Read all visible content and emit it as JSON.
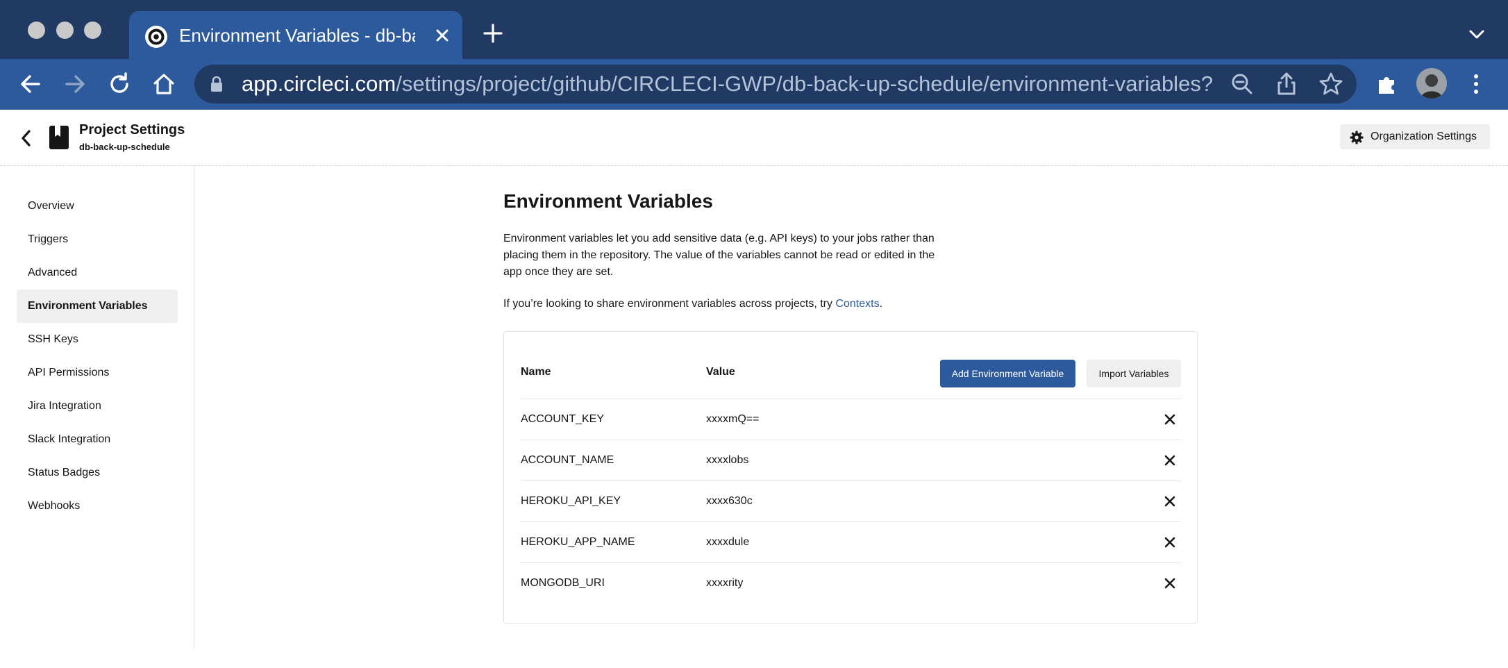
{
  "browser": {
    "tab_title": "Environment Variables - db-back-up-schedule",
    "url_host": "app.circleci.com",
    "url_path": "/settings/project/github/CIRCLECI-GWP/db-back-up-schedule/environment-variables?r..."
  },
  "header": {
    "title": "Project Settings",
    "subtitle": "db-back-up-schedule",
    "org_settings_label": "Organization Settings"
  },
  "sidebar": {
    "items": [
      {
        "label": "Overview"
      },
      {
        "label": "Triggers"
      },
      {
        "label": "Advanced"
      },
      {
        "label": "Environment Variables",
        "active": true
      },
      {
        "label": "SSH Keys"
      },
      {
        "label": "API Permissions"
      },
      {
        "label": "Jira Integration"
      },
      {
        "label": "Slack Integration"
      },
      {
        "label": "Status Badges"
      },
      {
        "label": "Webhooks"
      }
    ]
  },
  "main": {
    "title": "Environment Variables",
    "intro": "Environment variables let you add sensitive data (e.g. API keys) to your jobs rather than placing them in the repository. The value of the variables cannot be read or edited in the app once they are set.",
    "share_text": "If you’re looking to share environment variables across projects, try ",
    "share_link": "Contexts",
    "share_end": ".",
    "table": {
      "col_name": "Name",
      "col_value": "Value",
      "add_label": "Add Environment Variable",
      "import_label": "Import Variables",
      "rows": [
        {
          "name": "ACCOUNT_KEY",
          "value": "xxxxmQ=="
        },
        {
          "name": "ACCOUNT_NAME",
          "value": "xxxxlobs"
        },
        {
          "name": "HEROKU_API_KEY",
          "value": "xxxx630c"
        },
        {
          "name": "HEROKU_APP_NAME",
          "value": "xxxxdule"
        },
        {
          "name": "MONGODB_URI",
          "value": "xxxxrity"
        }
      ]
    }
  },
  "colors": {
    "chrome_dark": "#203a63",
    "chrome_tab": "#2c5a9c",
    "accent": "#2c5a9c"
  }
}
